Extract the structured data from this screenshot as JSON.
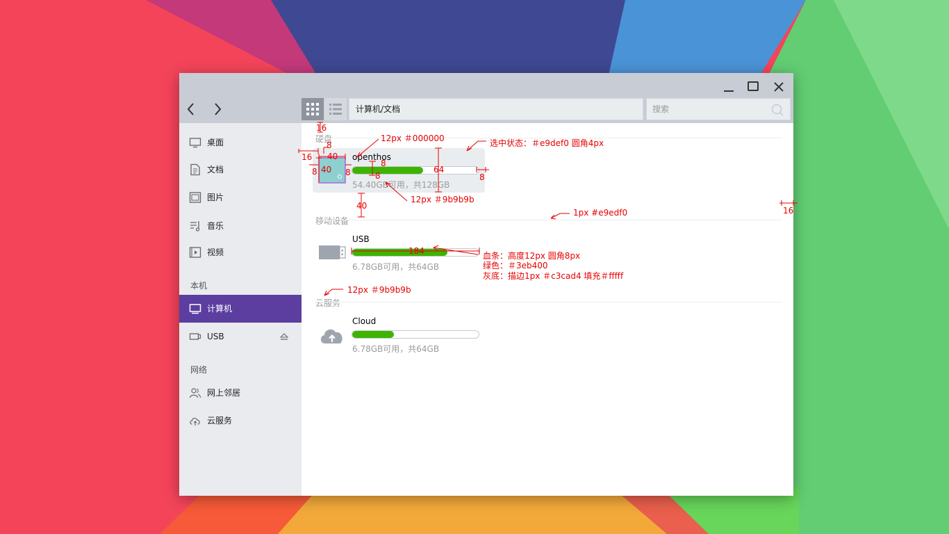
{
  "window": {
    "controls": {
      "minimize": "minimize-icon",
      "maximize": "maximize-icon",
      "close": "close-icon"
    }
  },
  "toolbar": {
    "path": "计算机/文档",
    "search_placeholder": "搜索"
  },
  "sidebar": {
    "items": [
      {
        "label": "桌面",
        "icon": "desktop-icon"
      },
      {
        "label": "文档",
        "icon": "document-icon"
      },
      {
        "label": "图片",
        "icon": "picture-icon"
      },
      {
        "label": "音乐",
        "icon": "music-icon"
      },
      {
        "label": "视频",
        "icon": "video-icon"
      }
    ],
    "local_section": "本机",
    "local_items": [
      {
        "label": "计算机",
        "icon": "computer-icon",
        "active": true
      },
      {
        "label": "USB",
        "icon": "usb-icon"
      }
    ],
    "network_section": "网络",
    "network_items": [
      {
        "label": "网上邻居",
        "icon": "network-neighbors-icon"
      },
      {
        "label": "云服务",
        "icon": "cloud-service-icon"
      }
    ]
  },
  "content": {
    "sections": {
      "disk": "硬盘",
      "mobile": "移动设备",
      "cloud": "云服务"
    },
    "devices": [
      {
        "name": "openthos",
        "info": "54.40GB可用，共128GB",
        "usage": 0.56,
        "selected": true,
        "icon": "hard-disk-icon"
      },
      {
        "name": "USB",
        "info": "6.78GB可用，共64GB",
        "usage": 0.75,
        "selected": false,
        "icon": "usb-drive-icon"
      },
      {
        "name": "Cloud",
        "info": "6.78GB可用，共64GB",
        "usage": 0.33,
        "selected": false,
        "icon": "cloud-upload-icon"
      }
    ]
  },
  "colors": {
    "accent": "#5b3ea0",
    "bar_fill": "#3eb400",
    "bar_border": "#c3cad4",
    "selected_bg": "#e9edf0",
    "divider": "#e9edf0",
    "secondary_text": "#9b9b9b",
    "annotation": "#e60000"
  },
  "annotations": {
    "a16_top": "16",
    "a8_top": "8",
    "a16_left": "16",
    "a40_w": "40",
    "a40_h": "40",
    "a8_l": "8",
    "a8_r": "8",
    "a8_bar1": "8",
    "a8_bar2": "8",
    "a64": "64",
    "a8_right": "8",
    "a40_gap": "40",
    "a16_edge": "16",
    "a184": "184",
    "name_spec": "12px ＃000000",
    "selected_spec": "选中状态：＃e9def0  圆角4px",
    "info_spec": "12px ＃9b9b9b",
    "divider_spec": "1px #e9edf0",
    "bar_spec_1": "血条：高度12px    圆角8px",
    "bar_spec_2": "绿色：＃3eb400",
    "bar_spec_3": "灰底：描边1px  ＃c3cad4   填充＃fffff",
    "section_spec": "12px ＃9b9b9b"
  }
}
